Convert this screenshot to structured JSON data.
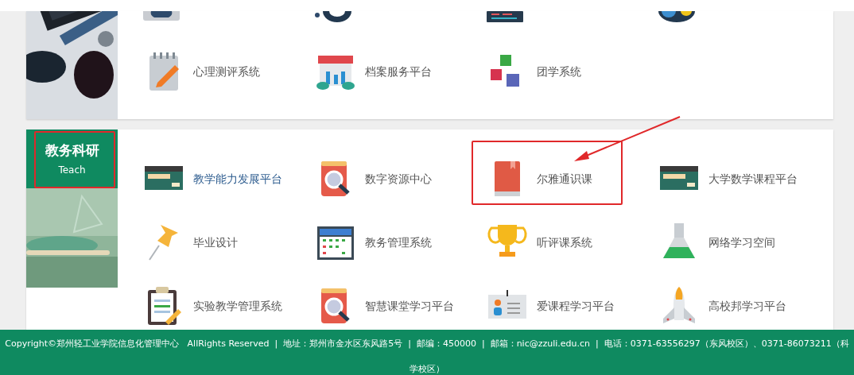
{
  "sections": [
    {
      "items": [
        {
          "kind": "reader"
        },
        {
          "kind": "headset"
        },
        {
          "kind": "screen"
        },
        {
          "kind": "gears"
        },
        {
          "kind": "notepad",
          "label": "心理测评系统",
          "active": false,
          "highlighted": false
        },
        {
          "kind": "store",
          "label": "档案服务平台",
          "active": false,
          "highlighted": false
        },
        {
          "kind": "blocks",
          "label": "团学系统",
          "active": false,
          "highlighted": false
        }
      ]
    },
    {
      "header": {
        "title": "教务科研",
        "subtitle": "Teach",
        "highlighted": true
      },
      "items": [
        {
          "kind": "card",
          "label": "教学能力发展平台",
          "active": true,
          "highlighted": false
        },
        {
          "kind": "search",
          "label": "数字资源中心",
          "active": false,
          "highlighted": false
        },
        {
          "kind": "book",
          "label": "尔雅通识课",
          "active": false,
          "highlighted": true
        },
        {
          "kind": "card",
          "label": "大学数学课程平台",
          "active": false,
          "highlighted": false
        },
        {
          "kind": "pin",
          "label": "毕业设计",
          "active": false,
          "highlighted": false
        },
        {
          "kind": "calendar",
          "label": "教务管理系统",
          "active": false,
          "highlighted": false
        },
        {
          "kind": "trophy",
          "label": "听评课系统",
          "active": false,
          "highlighted": false
        },
        {
          "kind": "flask",
          "label": "网络学习空间",
          "active": false,
          "highlighted": false
        },
        {
          "kind": "clipboard",
          "label": "实验教学管理系统",
          "active": false,
          "highlighted": false
        },
        {
          "kind": "search",
          "label": "智慧课堂学习平台",
          "active": false,
          "highlighted": false
        },
        {
          "kind": "badge",
          "label": "爱课程学习平台",
          "active": false,
          "highlighted": false
        },
        {
          "kind": "rocket",
          "label": "高校邦学习平台",
          "active": false,
          "highlighted": false
        }
      ]
    }
  ],
  "annotation_arrow": true,
  "footer": "Copyright©郑州轻工业学院信息化管理中心   AllRights Reserved  |  地址：郑州市金水区东风路5号  |  邮编：450000  |  邮箱：nic@zzuli.edu.cn  |  电话：0371-63556297（东风校区）、0371-86073211（科学校区）"
}
